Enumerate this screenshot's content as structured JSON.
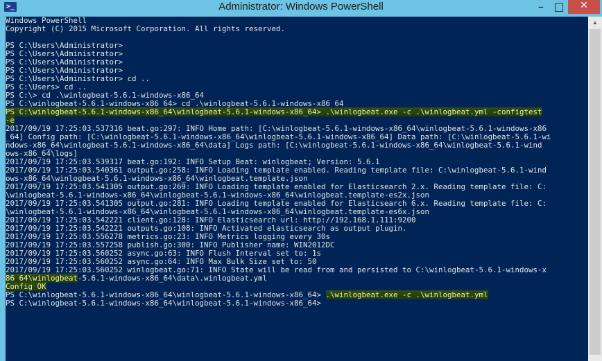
{
  "window": {
    "title": "Administrator: Windows PowerShell",
    "icon": "powershell-icon",
    "icon_glyph": ">_",
    "minimize": "–",
    "maximize": "□",
    "close": "✕"
  },
  "scrollbar": {
    "up_arrow": "▲"
  },
  "console": {
    "lines": [
      {
        "text": "Windows PowerShell"
      },
      {
        "text": "Copyright (C) 2015 Microsoft Corporation. All rights reserved."
      },
      {
        "text": ""
      },
      {
        "text": "PS C:\\Users\\Administrator>"
      },
      {
        "text": "PS C:\\Users\\Administrator>"
      },
      {
        "text": "PS C:\\Users\\Administrator>"
      },
      {
        "text": "PS C:\\Users\\Administrator>"
      },
      {
        "text": "PS C:\\Users\\Administrator> cd .."
      },
      {
        "text": "PS C:\\Users> cd .."
      },
      {
        "text": "PS C:\\> cd .\\winlogbeat-5.6.1-windows-x86_64"
      },
      {
        "text": "PS C:\\winlogbeat-5.6.1-windows-x86_64> cd .\\winlogbeat-5.6.1-windows-x86_64"
      },
      {
        "text": "PS C:\\winlogbeat-5.6.1-windows-x86_64\\winlogbeat-5.6.1-windows-x86_64> .\\winlogbeat.exe -c .\\winlogbeat.yml -configtest",
        "hl": true
      },
      {
        "text": "-e",
        "hl": true
      },
      {
        "text": "2017/09/19 17:25:03.537316 beat.go:297: INFO Home path: [C:\\winlogbeat-5.6.1-windows-x86_64\\winlogbeat-5.6.1-windows-x86"
      },
      {
        "text": "_64] Config path: [C:\\winlogbeat-5.6.1-windows-x86_64\\winlogbeat-5.6.1-windows-x86_64] Data path: [C:\\winlogbeat-5.6.1-wi"
      },
      {
        "text": "ndows-x86_64\\winlogbeat-5.6.1-windows-x86_64\\data] Logs path: [C:\\winlogbeat-5.6.1-windows-x86_64\\winlogbeat-5.6.1-wind"
      },
      {
        "text": "ows-x86_64\\logs]"
      },
      {
        "text": "2017/09/19 17:25:03.539317 beat.go:192: INFO Setup Beat: winlogbeat; Version: 5.6.1"
      },
      {
        "text": "2017/09/19 17:25:03.540361 output.go:258: INFO Loading template enabled. Reading template file: C:\\winlogbeat-5.6.1-wind"
      },
      {
        "text": "ows-x86_64\\winlogbeat-5.6.1-windows-x86_64\\winlogbeat.template.json"
      },
      {
        "text": "2017/09/19 17:25:03.541305 output.go:269: INFO Loading template enabled for Elasticsearch 2.x. Reading template file: C:"
      },
      {
        "text": "\\winlogbeat-5.6.1-windows-x86_64\\winlogbeat-5.6.1-windows-x86_64\\winlogbeat.template-es2x.json"
      },
      {
        "text": "2017/09/19 17:25:03.541305 output.go:281: INFO Loading template enabled for Elasticsearch 6.x. Reading template file: C:"
      },
      {
        "text": "\\winlogbeat-5.6.1-windows-x86_64\\winlogbeat-5.6.1-windows-x86_64\\winlogbeat.template-es6x.json"
      },
      {
        "text": "2017/09/19 17:25:03.542221 client.go:128: INFO Elasticsearch url: http://192.168.1.111:9200"
      },
      {
        "text": "2017/09/19 17:25:03.542221 outputs.go:108: INFO Activated elasticsearch as output plugin."
      },
      {
        "text": "2017/09/19 17:25:03.556278 metrics.go:23: INFO Metrics logging every 30s"
      },
      {
        "text": "2017/09/19 17:25:03.557258 publish.go:300: INFO Publisher name: WIN2012DC"
      },
      {
        "text": "2017/09/19 17:25:03.560252 async.go:63: INFO Flush Interval set to: 1s"
      },
      {
        "text": "2017/09/19 17:25:03.560252 async.go:64: INFO Max Bulk Size set to: 50"
      },
      {
        "text": "2017/09/19 17:25:03.560252 winlogbeat.go:71: INFO State will be read from and persisted to C:\\winlogbeat-5.6.1-windows-x"
      },
      {
        "text": "",
        "segs": [
          {
            "t": "86_64\\winlogbeat",
            "hl": true
          },
          {
            "t": "-5.6.1-windows-x86_64\\data\\.winlogbeat.yml"
          }
        ]
      },
      {
        "text": "",
        "segs": [
          {
            "t": "Config OK",
            "hl": true
          }
        ]
      },
      {
        "text": "",
        "segs": [
          {
            "t": "PS C:\\winlogbeat-5.6.1-windows-x86_64\\winlogbeat-5.6.1-windows-x86_64> "
          },
          {
            "t": ".\\winlogbeat.exe -c .\\winlogbeat.yml",
            "hl": true
          }
        ]
      },
      {
        "text": "PS C:\\winlogbeat-5.6.1-windows-x86_64\\winlogbeat-5.6.1-windows-x86_64>"
      }
    ]
  }
}
